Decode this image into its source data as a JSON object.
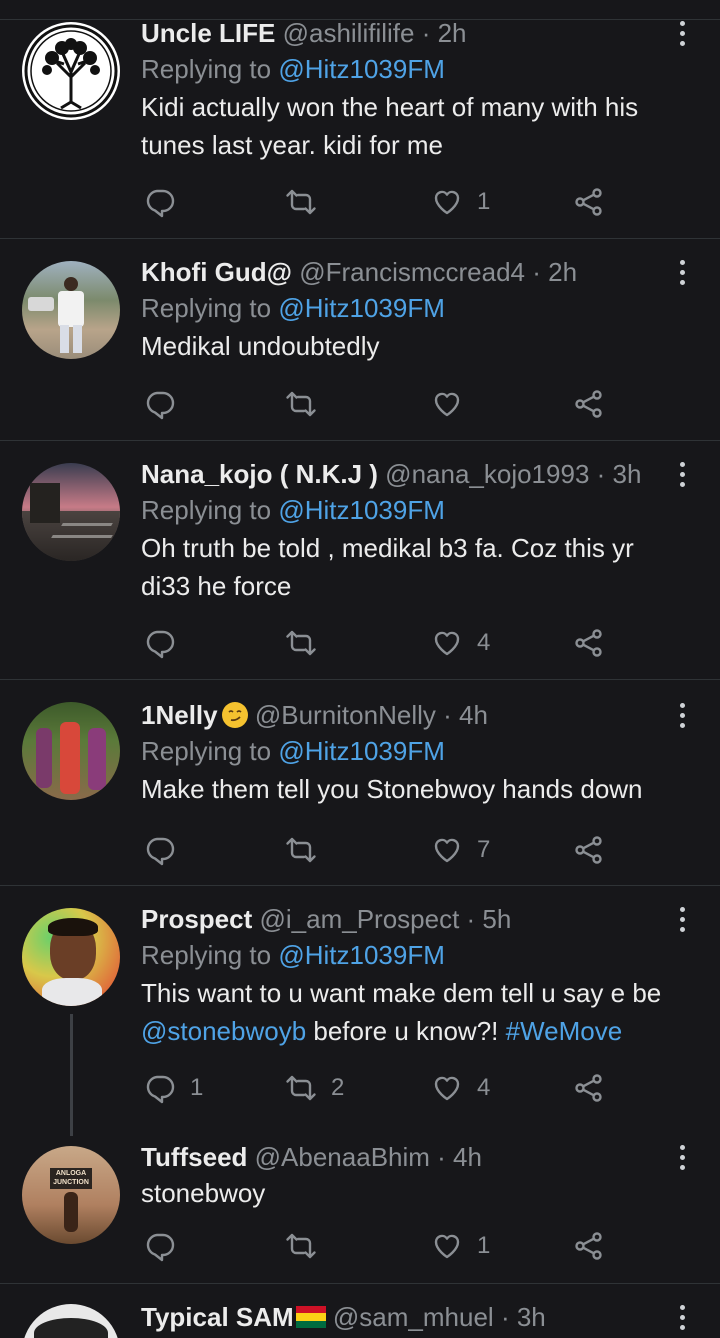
{
  "colors": {
    "background": "#17171a",
    "mention": "#4fa3e6",
    "muted": "#8b8f94"
  },
  "tweets": [
    {
      "name": "Uncle LIFE",
      "handle": "@ashilifilife",
      "time": "· 2h",
      "replying_prefix": "Replying to ",
      "replying_to": "@Hitz1039FM",
      "lines": [
        "Kidi actually won the heart of many with his",
        "tunes last year. kidi for me"
      ],
      "replies": "",
      "retweets": "",
      "likes": "1"
    },
    {
      "name": "Khofi Gud@",
      "handle": "@Francismccread4",
      "time": "· 2h",
      "replying_prefix": "Replying to ",
      "replying_to": "@Hitz1039FM",
      "lines": [
        "Medikal undoubtedly"
      ],
      "replies": "",
      "retweets": "",
      "likes": ""
    },
    {
      "name": "Nana_kojo ( N.K.J )",
      "handle": "@nana_kojo1993",
      "time": "· 3h",
      "replying_prefix": "Replying to ",
      "replying_to": "@Hitz1039FM",
      "lines": [
        "Oh truth be told , medikal b3 fa. Coz this yr",
        "di33 he force"
      ],
      "replies": "",
      "retweets": "",
      "likes": "4"
    },
    {
      "name": "1Nelly",
      "handle": "@BurnitonNelly",
      "time": "· 4h",
      "replying_prefix": "Replying to ",
      "replying_to": "@Hitz1039FM",
      "lines": [
        "Make them tell you Stonebwoy hands down"
      ],
      "replies": "",
      "retweets": "",
      "likes": "7",
      "emoji": "smirk-emoji"
    },
    {
      "name": "Prospect",
      "handle": "@i_am_Prospect",
      "time": "· 5h",
      "replying_prefix": "Replying to ",
      "replying_to": "@Hitz1039FM",
      "lines": [
        "This want to u want make dem tell u say e be"
      ],
      "line2_link": "@stonebwoyb",
      "line2_mid": " before u know?! ",
      "line2_tag": "#WeMove",
      "replies": "1",
      "retweets": "2",
      "likes": "4"
    },
    {
      "name": "Tuffseed",
      "handle": "@AbenaaBhim",
      "time": "· 4h",
      "lines": [
        "stonebwoy"
      ],
      "replies": "",
      "retweets": "",
      "likes": "1",
      "avatar_text": "ANLOGA JUNCTION"
    },
    {
      "name": "Typical SAM",
      "handle": "@sam_mhuel",
      "time": "· 3h",
      "flag": "ghana-flag"
    }
  ]
}
